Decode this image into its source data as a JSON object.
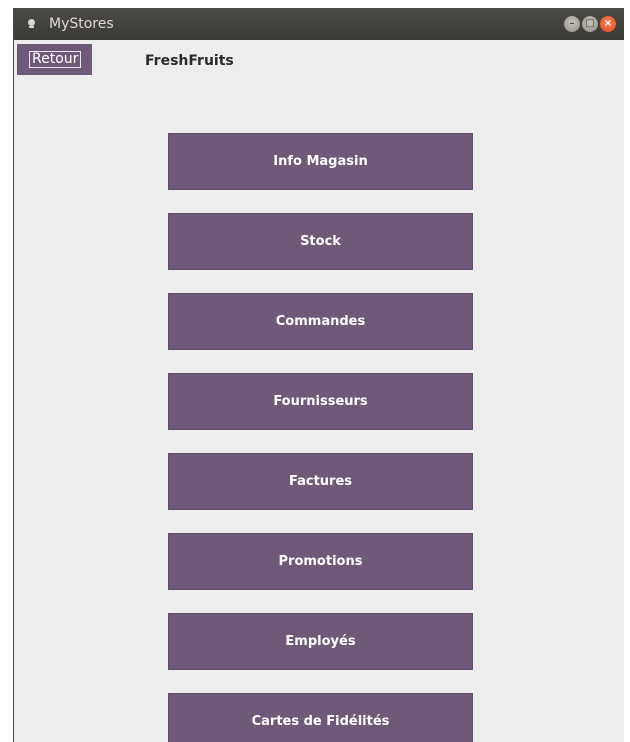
{
  "window": {
    "title": "MyStores",
    "icon": "lightbulb-icon"
  },
  "header": {
    "back_label": "Retour",
    "store_name": "FreshFruits"
  },
  "menu": {
    "items": [
      {
        "label": "Info Magasin"
      },
      {
        "label": "Stock"
      },
      {
        "label": "Commandes"
      },
      {
        "label": "Fournisseurs"
      },
      {
        "label": "Factures"
      },
      {
        "label": "Promotions"
      },
      {
        "label": "Employés"
      },
      {
        "label": "Cartes de Fidélités"
      }
    ]
  },
  "colors": {
    "button_bg": "#6e5a78",
    "window_bg": "#ededed",
    "titlebar_bg": "#3f3e39",
    "close_button": "#e95420"
  }
}
